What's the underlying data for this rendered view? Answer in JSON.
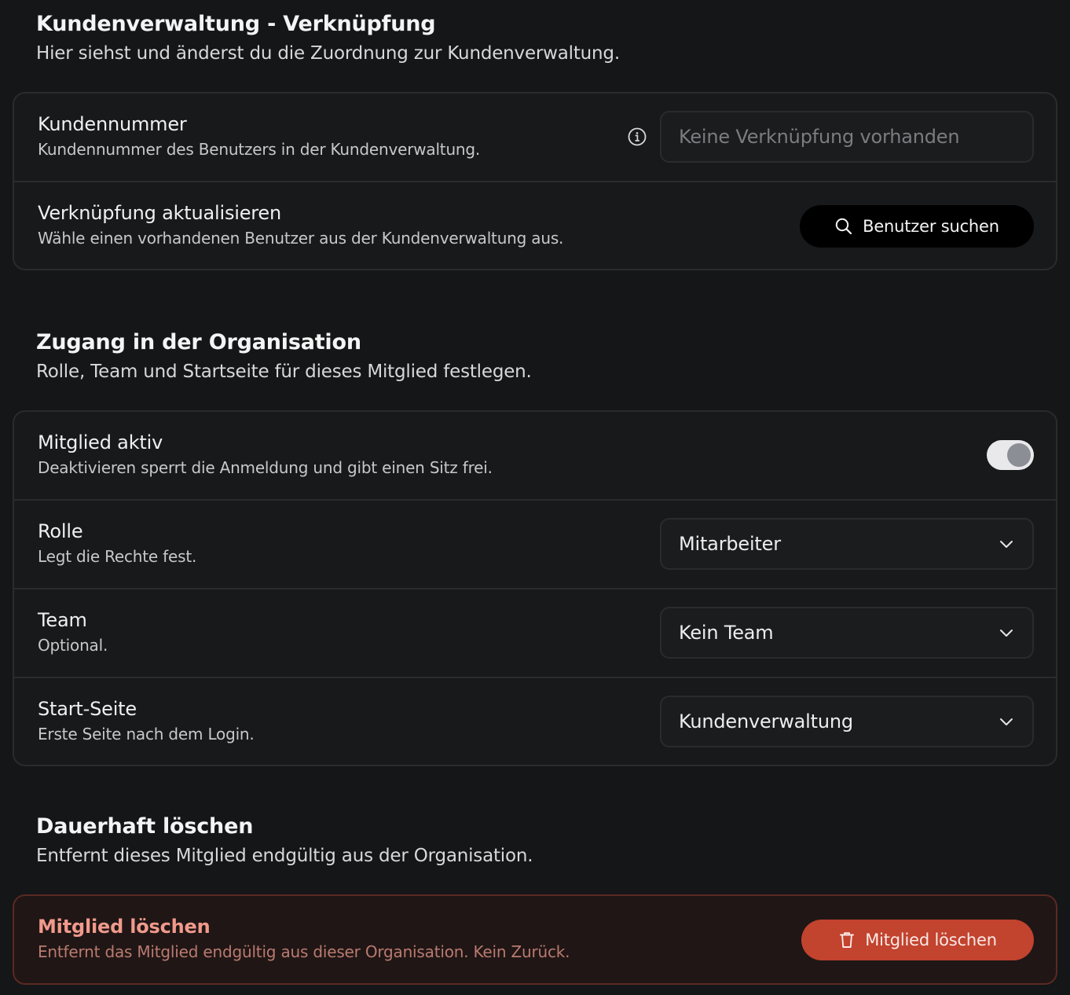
{
  "link_section": {
    "title": "Kundenverwaltung - Verknüpfung",
    "subtitle": "Hier siehst und änderst du die Zuordnung zur Kundenverwaltung.",
    "customer_number": {
      "label": "Kundennummer",
      "description": "Kundennummer des Benutzers in der Kundenverwaltung.",
      "placeholder": "Keine Verknüpfung vorhanden",
      "value": "",
      "icon": "info-icon"
    },
    "update_link": {
      "label": "Verknüpfung aktualisieren",
      "description": "Wähle einen vorhandenen Benutzer aus der Kundenverwaltung aus.",
      "button_label": "Benutzer suchen",
      "button_icon": "search-icon"
    }
  },
  "access_section": {
    "title": "Zugang in der Organisation",
    "subtitle": "Rolle, Team und Startseite für dieses Mitglied festlegen.",
    "active": {
      "label": "Mitglied aktiv",
      "description": "Deaktivieren sperrt die Anmeldung und gibt einen Sitz frei.",
      "enabled": true
    },
    "role": {
      "label": "Rolle",
      "description": "Legt die Rechte fest.",
      "selected": "Mitarbeiter"
    },
    "team": {
      "label": "Team",
      "description": "Optional.",
      "selected": "Kein Team"
    },
    "start_page": {
      "label": "Start-Seite",
      "description": "Erste Seite nach dem Login.",
      "selected": "Kundenverwaltung"
    }
  },
  "delete_section": {
    "title": "Dauerhaft löschen",
    "subtitle": "Entfernt dieses Mitglied endgültig aus der Organisation.",
    "label": "Mitglied löschen",
    "description": "Entfernt das Mitglied endgültig aus dieser Organisation. Kein Zurück.",
    "button_label": "Mitglied löschen",
    "button_icon": "trash-icon"
  },
  "colors": {
    "background": "#151618",
    "card": "#18191b",
    "border": "#2a2b2e",
    "danger_button": "#c2432e",
    "danger_text": "#f09a8c"
  }
}
